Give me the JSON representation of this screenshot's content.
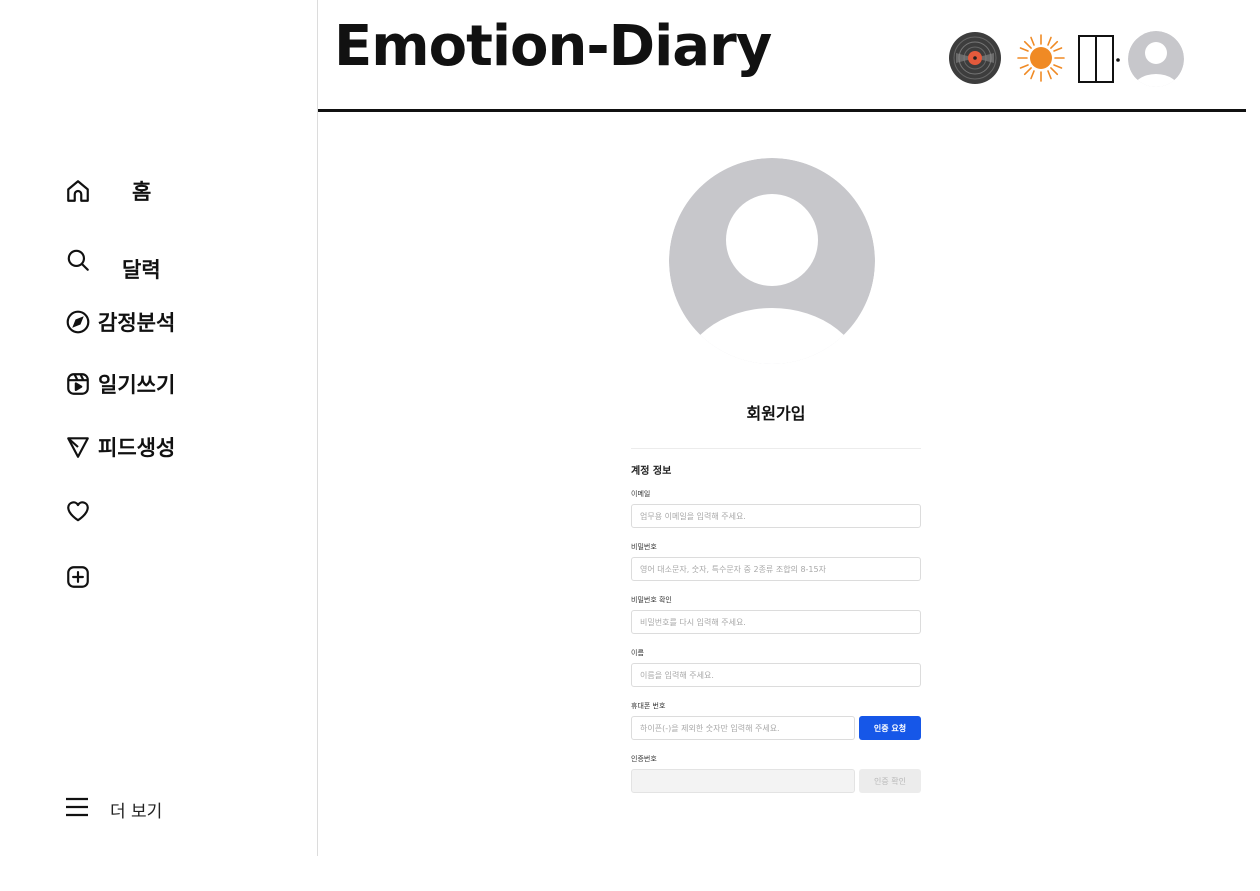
{
  "header": {
    "logo": "Emotion-Diary"
  },
  "sidebar": {
    "items": [
      {
        "label": "홈",
        "icon": "home-icon"
      },
      {
        "label": "달력",
        "icon": "search-icon"
      },
      {
        "label": "감정분석",
        "icon": "compass-icon"
      },
      {
        "label": "일기쓰기",
        "icon": "reels-icon"
      },
      {
        "label": "피드생성",
        "icon": "send-icon"
      },
      {
        "label": "",
        "icon": "heart-icon"
      },
      {
        "label": "",
        "icon": "plus-square-icon"
      }
    ],
    "more_label": "더 보기"
  },
  "form": {
    "title": "회원가입",
    "section_title": "계정 정보",
    "email": {
      "label": "이메일",
      "placeholder": "업무용 이메일을 입력해 주세요."
    },
    "password": {
      "label": "비밀번호",
      "placeholder": "영어 대소문자, 숫자, 특수문자 중 2종류 조합의 8-15자"
    },
    "password_confirm": {
      "label": "비밀번호 확인",
      "placeholder": "비밀번호를 다시 입력해 주세요."
    },
    "name": {
      "label": "이름",
      "placeholder": "이름을 입력해 주세요."
    },
    "phone": {
      "label": "휴대폰 번호",
      "placeholder": "하이픈(-)을 제외한 숫자만 입력해 주세요.",
      "button": "인증 요청"
    },
    "verify": {
      "label": "인증번호",
      "placeholder": "",
      "button": "인증 확인"
    }
  },
  "colors": {
    "primary": "#1657e8",
    "avatar_gray": "#c7c7cb",
    "sun": "#f08a24"
  }
}
